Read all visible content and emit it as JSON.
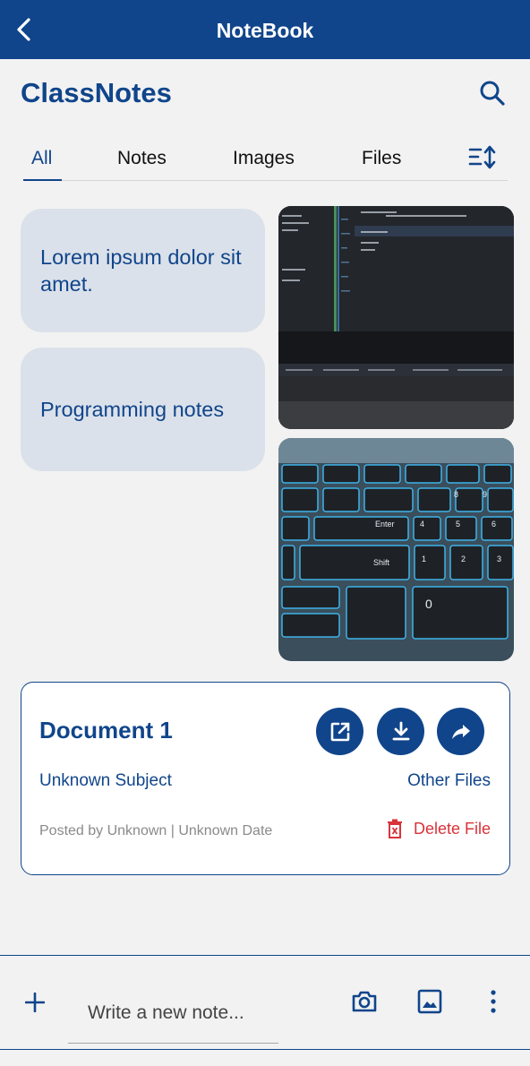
{
  "appbar": {
    "title": "NoteBook",
    "back_icon": "chevron-left-icon"
  },
  "header": {
    "title": "ClassNotes",
    "search_icon": "search-icon"
  },
  "tabs": [
    {
      "label": "All",
      "active": true
    },
    {
      "label": "Notes",
      "active": false
    },
    {
      "label": "Images",
      "active": false
    },
    {
      "label": "Files",
      "active": false
    }
  ],
  "sort_icon": "sort-icon",
  "notes": [
    {
      "text": "Lorem ipsum dolor sit amet."
    },
    {
      "text": "Programming notes"
    }
  ],
  "images": [
    {
      "subject": "laptop screen with code editor"
    },
    {
      "subject": "backlit laptop keyboard"
    }
  ],
  "document": {
    "title": "Document 1",
    "subject": "Unknown Subject",
    "file_type": "Other Files",
    "meta": "Posted by Unknown | Unknown Date",
    "delete_label": "Delete File",
    "actions": [
      "open-external-icon",
      "download-icon",
      "share-icon"
    ]
  },
  "composer": {
    "placeholder": "Write a new note...",
    "icons": [
      "plus-icon",
      "camera-icon",
      "image-icon",
      "more-vertical-icon"
    ]
  },
  "colors": {
    "primary": "#10458b",
    "note_bg": "#dbe1ea",
    "danger": "#d9333a",
    "background": "#f2f2f2"
  }
}
